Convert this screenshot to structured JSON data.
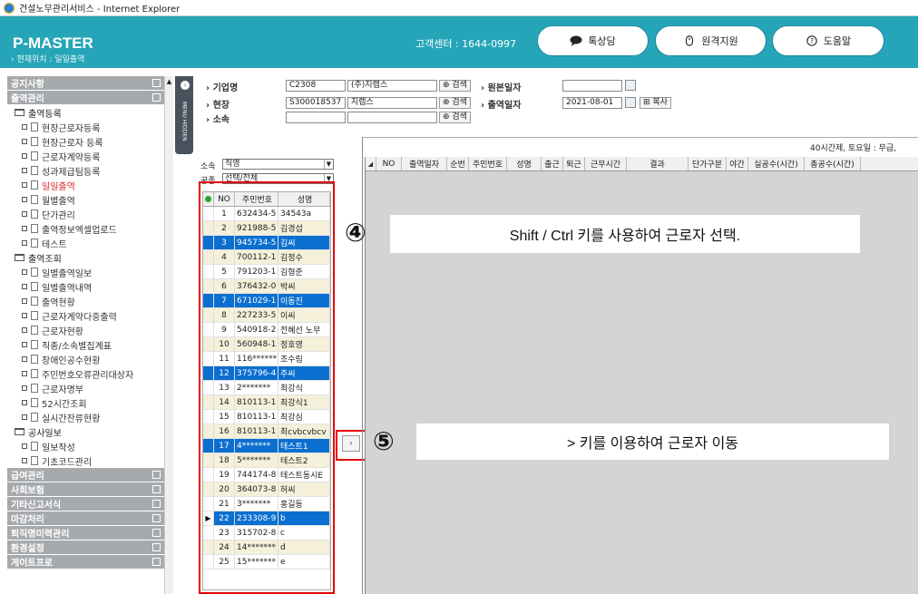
{
  "window": {
    "title": "건설노무관리서비스 - Internet Explorer"
  },
  "header": {
    "logo": "P-MASTER",
    "location": "› 현재위치 : 일일출역",
    "support": "고객센터 : 1644-0997",
    "buttons": [
      "톡상담",
      "원격지원",
      "도움말"
    ],
    "accent": "#26a5b8"
  },
  "sidebar": {
    "sections_top": [
      {
        "label": "공지사항"
      },
      {
        "label": "출역관리"
      }
    ],
    "groups": [
      {
        "label": "출역등록",
        "items": [
          "현장근로자등록",
          "현장근로자 등록",
          "근로자계약등록",
          "성과제급팀등록",
          "일일출역",
          "월별출역",
          "단가관리",
          "출역정보엑셀업로드",
          "테스트"
        ]
      },
      {
        "label": "출역조회",
        "items": [
          "일별출역일보",
          "일별출역내역",
          "출역현황",
          "근로자계약다중출력",
          "근로자현황",
          "직종/소속별집계표",
          "장애인공수현황",
          "주민번호오류관리대상자",
          "근로자명부",
          "52시간조회",
          "실시간잔류현황"
        ]
      },
      {
        "label": "공사일보",
        "items": [
          "일보작성",
          "기초코드관리"
        ]
      }
    ],
    "active_item": "일일출역",
    "sections_bottom": [
      {
        "label": "급여관리"
      },
      {
        "label": "사회보험"
      },
      {
        "label": "기타신고서식"
      },
      {
        "label": "마감처리"
      },
      {
        "label": "퇴직명미력관리"
      },
      {
        "label": "환경설정"
      },
      {
        "label": "게이트프로"
      }
    ],
    "hide_label": "MENU HIDDEN"
  },
  "form": {
    "company_label": "› 기업명",
    "company_code": "C2308",
    "company_name": "(주)지렙스",
    "site_label": "› 현장",
    "site_code": "S300018537",
    "site_name": "지렙스",
    "affil_label": "› 소속",
    "search": "검색",
    "base_date_label": "› 원본일자",
    "base_date": "",
    "work_date_label": "› 출역일자",
    "work_date": "2021-08-01",
    "copy": "복사"
  },
  "info": "40시간제, 토요일 : 무급,",
  "filters": {
    "affil_label": "소속",
    "affil_value": "직영",
    "trade_label": "공종",
    "trade_value": "선택/전체"
  },
  "left_grid": {
    "headers": [
      "NO",
      "주민번호",
      "성명"
    ],
    "rows": [
      {
        "no": "1",
        "rrn": "632434-5",
        "name": "34543a",
        "style": "n"
      },
      {
        "no": "2",
        "rrn": "921988-5",
        "name": "김경섭",
        "style": "alt"
      },
      {
        "no": "3",
        "rrn": "945734-5",
        "name": "김씨",
        "style": "sel"
      },
      {
        "no": "4",
        "rrn": "700112-1",
        "name": "김정수",
        "style": "alt"
      },
      {
        "no": "5",
        "rrn": "791203-1",
        "name": "김형준",
        "style": "n"
      },
      {
        "no": "6",
        "rrn": "376432-0",
        "name": "박씨",
        "style": "alt"
      },
      {
        "no": "7",
        "rrn": "671029-1",
        "name": "이동진",
        "style": "sel"
      },
      {
        "no": "8",
        "rrn": "227233-5",
        "name": "이씨",
        "style": "alt"
      },
      {
        "no": "9",
        "rrn": "540918-2",
        "name": "전혜선 노무",
        "style": "n"
      },
      {
        "no": "10",
        "rrn": "560948-1",
        "name": "정호영",
        "style": "alt"
      },
      {
        "no": "11",
        "rrn": "116******",
        "name": "조수림",
        "style": "n"
      },
      {
        "no": "12",
        "rrn": "375796-4",
        "name": "주씨",
        "style": "sel"
      },
      {
        "no": "13",
        "rrn": "2*******",
        "name": "최강식",
        "style": "n"
      },
      {
        "no": "14",
        "rrn": "810113-1",
        "name": "최강식1",
        "style": "alt"
      },
      {
        "no": "15",
        "rrn": "810113-1",
        "name": "최강심",
        "style": "n"
      },
      {
        "no": "16",
        "rrn": "810113-1",
        "name": "최cvbcvbcv",
        "style": "alt"
      },
      {
        "no": "17",
        "rrn": "4*******",
        "name": "테스트1",
        "style": "sel"
      },
      {
        "no": "18",
        "rrn": "5*******",
        "name": "테스트2",
        "style": "alt"
      },
      {
        "no": "19",
        "rrn": "744174-8",
        "name": "테스트동시E",
        "style": "n"
      },
      {
        "no": "20",
        "rrn": "364073-8",
        "name": "허씨",
        "style": "alt"
      },
      {
        "no": "21",
        "rrn": "3*******",
        "name": "홍길동",
        "style": "n"
      },
      {
        "no": "22",
        "rrn": "233308-9",
        "name": "b",
        "style": "sel",
        "current": true
      },
      {
        "no": "23",
        "rrn": "315702-8",
        "name": "c",
        "style": "n"
      },
      {
        "no": "24",
        "rrn": "14*******",
        "name": "d",
        "style": "alt"
      },
      {
        "no": "25",
        "rrn": "15*******",
        "name": "e",
        "style": "n"
      }
    ]
  },
  "right_grid": {
    "headers": [
      "NO",
      "출역일자",
      "순번",
      "주민번호",
      "성명",
      "출근",
      "퇴근",
      "근무시간",
      "결과",
      "단가구분",
      "야간",
      "실공수(시간)",
      "총공수(시간)"
    ]
  },
  "move_button": "›",
  "annotations": {
    "step4_number": "④",
    "step4_text": "Shift / Ctrl 키를 사용하여 근로자 선택.",
    "step5_number": "⑤",
    "step5_text": "> 키를 이용하여 근로자 이동",
    "highlight_color": "#e30000"
  }
}
